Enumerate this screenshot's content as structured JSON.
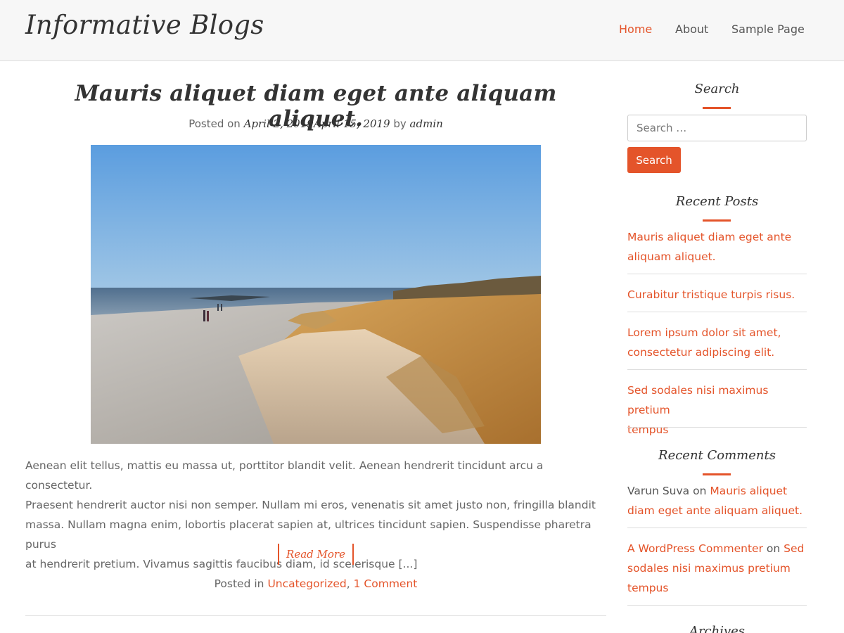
{
  "header": {
    "site_title": "Informative Blogs",
    "nav": [
      {
        "label": "Home",
        "active": true
      },
      {
        "label": "About",
        "active": false
      },
      {
        "label": "Sample Page",
        "active": false
      }
    ]
  },
  "post": {
    "title": "Mauris aliquet diam eget ante aliquam aliquet.",
    "meta_prefix": "Posted on",
    "date_published": "April 2, 2019",
    "date_updated": "April 15, 2019",
    "meta_by": "by",
    "author": "admin",
    "excerpt_lines": [
      "Aenean elit tellus, mattis eu massa ut, porttitor blandit velit. Aenean hendrerit tincidunt arcu a consectetur.",
      "Praesent hendrerit auctor nisi non semper. Nullam mi eros, venenatis sit amet justo non, fringilla blandit",
      "massa. Nullam magna enim, lobortis placerat sapien at, ultrices tincidunt sapien. Suspendisse pharetra purus",
      "at hendrerit pretium. Vivamus sagittis faucibus diam, id scelerisque [...]"
    ],
    "read_more": "Read More",
    "footer_prefix": "Posted in",
    "category": "Uncategorized",
    "separator": ",",
    "comments": "1 Comment"
  },
  "sidebar": {
    "search": {
      "title": "Search",
      "placeholder": "Search …",
      "button": "Search"
    },
    "recent_posts": {
      "title": "Recent Posts",
      "items": [
        {
          "line1": "Mauris aliquet diam eget ante",
          "line2": "aliquam aliquet."
        },
        {
          "line1": "Curabitur tristique turpis risus.",
          "line2": ""
        },
        {
          "line1": "Lorem ipsum dolor sit amet,",
          "line2": "consectetur adipiscing elit."
        },
        {
          "line1": "Sed sodales nisi maximus pretium",
          "line2": "tempus"
        }
      ]
    },
    "recent_comments": {
      "title": "Recent Comments",
      "items": [
        {
          "author": "Varun Suva",
          "on": "on",
          "post_a": "Mauris aliquet",
          "post_b": "diam eget ante aliquam aliquet."
        },
        {
          "author": "A WordPress Commenter",
          "on": "on",
          "post_a": "Sed",
          "post_b": "sodales nisi maximus pretium",
          "post_c": "tempus"
        }
      ]
    },
    "archives": {
      "title": "Archives"
    }
  },
  "colors": {
    "accent": "#e4542a",
    "header_bg": "#f7f7f7",
    "heading": "#333333",
    "text": "#666666"
  }
}
